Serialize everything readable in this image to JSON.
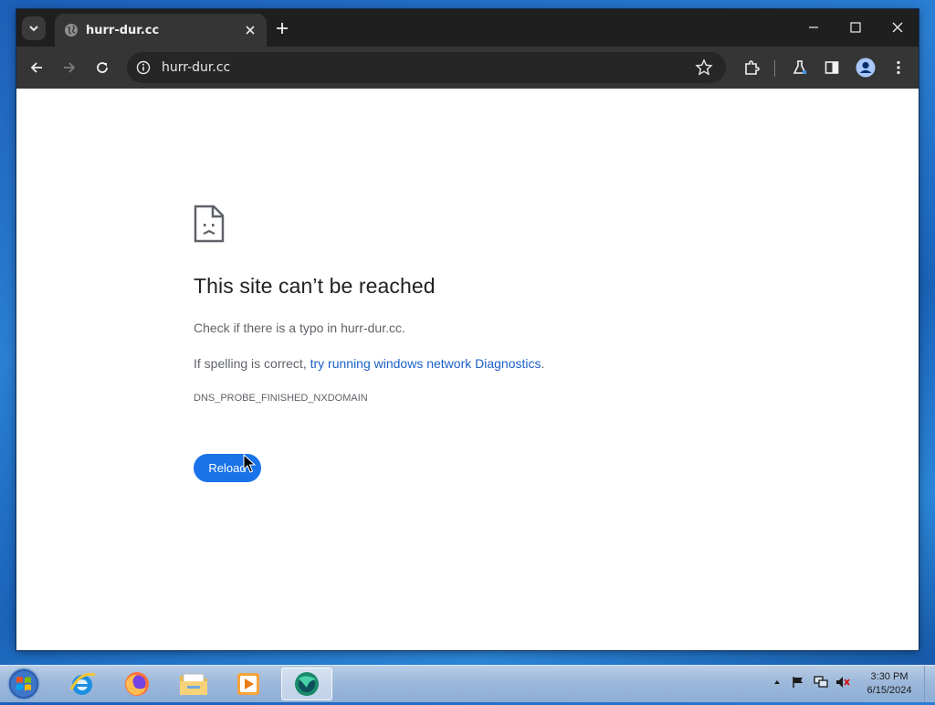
{
  "browser": {
    "tab_title": "hurr-dur.cc",
    "url": "hurr-dur.cc",
    "icons": {
      "tab_search": "chevron-down-icon",
      "tab_favicon": "globe-icon",
      "tab_close": "close-icon",
      "new_tab": "plus-icon",
      "minimize": "minimize-icon",
      "maximize": "maximize-icon",
      "close": "close-icon",
      "back": "back-arrow-icon",
      "forward": "forward-arrow-icon",
      "reload": "reload-icon",
      "site_info": "info-icon",
      "bookmark": "star-icon",
      "extensions": "puzzle-icon",
      "labs": "flask-icon",
      "side_panel": "side-panel-icon",
      "profile": "profile-icon",
      "menu": "kebab-menu-icon"
    }
  },
  "error_page": {
    "title": "This site can’t be reached",
    "check_text": "Check if there is a typo in hurr-dur.cc.",
    "spelling_prefix": "If spelling is correct, ",
    "diagnostics_link": "try running windows network Diagnostics",
    "spelling_suffix": ".",
    "error_code": "DNS_PROBE_FINISHED_NXDOMAIN",
    "reload_label": "Reload",
    "accent_color": "#1a73e8"
  },
  "taskbar": {
    "apps": [
      "internet-explorer-icon",
      "firefox-icon",
      "file-explorer-icon",
      "media-player-icon",
      "browser-app-icon"
    ],
    "clock_time": "3:30 PM",
    "clock_date": "6/15/2024"
  }
}
